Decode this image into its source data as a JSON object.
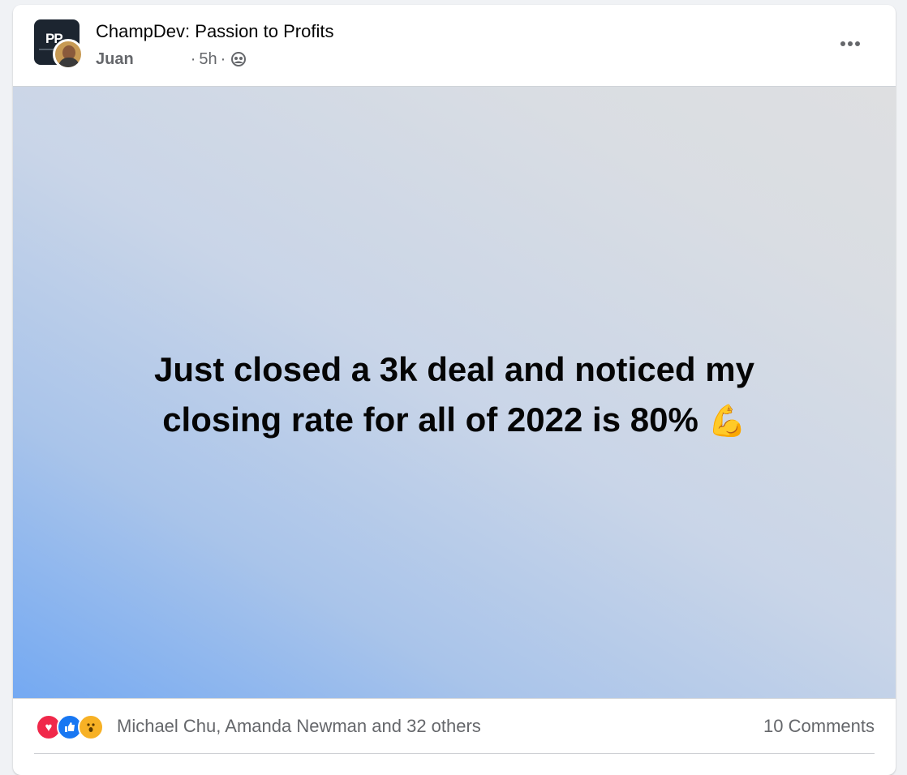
{
  "header": {
    "group_name": "ChampDev: Passion to Profits",
    "author": "Juan",
    "time": "5h",
    "separator": "·",
    "group_avatar_text": "PP",
    "audience_icon": "group-audience-icon",
    "more_icon": "more-options-icon"
  },
  "post": {
    "line1": "Just closed a 3k deal and noticed my",
    "line2": "closing rate for all of 2022 is 80%",
    "emoji": "💪"
  },
  "reactions": {
    "icons": [
      "love-reaction-icon",
      "like-reaction-icon",
      "wow-reaction-icon"
    ],
    "summary": "Michael Chu, Amanda Newman and 32 others",
    "comments": "10 Comments"
  },
  "colors": {
    "text_primary": "#050505",
    "text_secondary": "#65676b",
    "love": "#f0284a",
    "like": "#1877f2",
    "wow": "#f7b125"
  }
}
